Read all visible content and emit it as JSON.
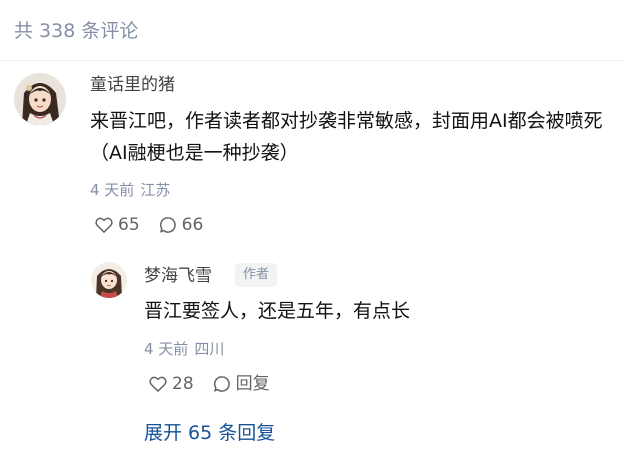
{
  "comments_header": {
    "count_text": "共 338 条评论"
  },
  "main_comment": {
    "author": "童话里的猪",
    "content": "来晋江吧，作者读者都对抄袭非常敏感，封面用AI都会被喷死（AI融梗也是一种抄袭）",
    "time": "4 天前",
    "location": "江苏",
    "likes": "65",
    "replies": "66",
    "avatar_icon": "illustrated-girl-avatar"
  },
  "reply": {
    "author": "梦海飞雪",
    "badge": "作者",
    "content": "晋江要签人，还是五年，有点长",
    "time": "4 天前",
    "location": "四川",
    "likes": "28",
    "reply_label": "回复",
    "avatar_icon": "illustrated-girl-avatar"
  },
  "expand_replies": {
    "label": "展开 65 条回复"
  },
  "colors": {
    "meta_gray": "#8590a6",
    "link_blue": "#175199",
    "text_main": "#121212"
  }
}
